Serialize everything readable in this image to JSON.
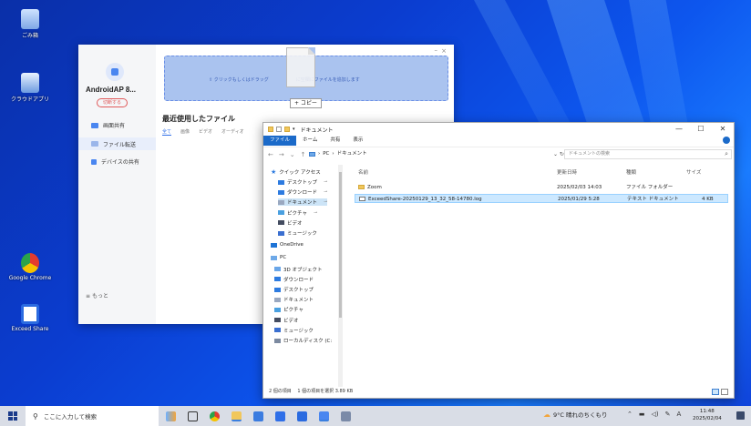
{
  "desktop": {
    "icons": [
      {
        "label": "ごみ箱",
        "name": "recycle-bin"
      },
      {
        "label": "クラウドアプリ",
        "name": "cloud-app"
      },
      {
        "label": "Google Chrome",
        "name": "chrome"
      },
      {
        "label": "Exceed Share",
        "name": "exceed-share"
      }
    ]
  },
  "app": {
    "device_name": "AndroidAP 8...",
    "switch_label": "切断する",
    "nav": [
      "画面共有",
      "ファイル転送",
      "デバイスの共有"
    ],
    "more": "もっと",
    "drop_text": "クリックもしくはドラッグ　　　　　　に空欄にファイルを追加します",
    "recent_title": "最近使用したファイル",
    "tabs": [
      "全て",
      "画像",
      "ビデオ",
      "オーディオ"
    ],
    "copy_tip": "+ コピー"
  },
  "explorer": {
    "title": "ドキュメント",
    "ribbon": [
      "ファイル",
      "ホーム",
      "共有",
      "表示"
    ],
    "breadcrumb": [
      "PC",
      "ドキュメント"
    ],
    "search_placeholder": "ドキュメントの検索",
    "quick_access": "クイック アクセス",
    "tree": [
      {
        "label": "デスクトップ",
        "pin": true,
        "color": "#2d7be0"
      },
      {
        "label": "ダウンロード",
        "pin": true,
        "color": "#2d7be0"
      },
      {
        "label": "ドキュメント",
        "pin": true,
        "color": "#9aa8c0",
        "selected": true
      },
      {
        "label": "ピクチャ",
        "pin": true,
        "color": "#4aa0e0"
      },
      {
        "label": "ビデオ",
        "pin": false,
        "color": "#444c60"
      },
      {
        "label": "ミュージック",
        "pin": false,
        "color": "#3a6fd0"
      },
      {
        "label": "OneDrive",
        "pin": false,
        "color": "#1e74d6"
      },
      {
        "label": "PC",
        "pin": false,
        "color": "#6ea9e8"
      },
      {
        "label": "3D オブジェクト",
        "pin": false,
        "color": "#6aa6e8"
      },
      {
        "label": "ダウンロード",
        "pin": false,
        "color": "#2d7be0"
      },
      {
        "label": "デスクトップ",
        "pin": false,
        "color": "#2d7be0"
      },
      {
        "label": "ドキュメント",
        "pin": false,
        "color": "#9aa8c0"
      },
      {
        "label": "ピクチャ",
        "pin": false,
        "color": "#4aa0e0"
      },
      {
        "label": "ビデオ",
        "pin": false,
        "color": "#444c60"
      },
      {
        "label": "ミュージック",
        "pin": false,
        "color": "#3a6fd0"
      },
      {
        "label": "ローカルディスク (C:",
        "pin": false,
        "color": "#7c8aa0"
      }
    ],
    "columns": [
      "名前",
      "更新日時",
      "種類",
      "サイズ"
    ],
    "files": [
      {
        "name": "Zoom",
        "date": "2025/02/03 14:03",
        "type": "ファイル フォルダー",
        "size": "",
        "kind": "folder"
      },
      {
        "name": "ExceedShare-20250129_13_32_58-14780.log",
        "date": "2025/01/29 5:28",
        "type": "テキスト ドキュメント",
        "size": "4 KB",
        "kind": "log",
        "selected": true
      }
    ],
    "status": "2 個の項目　 1 個の項目を選択 3.89 KB"
  },
  "taskbar": {
    "search": "ここに入力して検索",
    "weather": "9°C 晴れのちくもり",
    "time": "11:48",
    "date": "2025/02/04"
  },
  "colors": {
    "accent": "#1b6ac9",
    "app_accent": "#2f6fe8",
    "taskbar": "#d9dde6"
  }
}
